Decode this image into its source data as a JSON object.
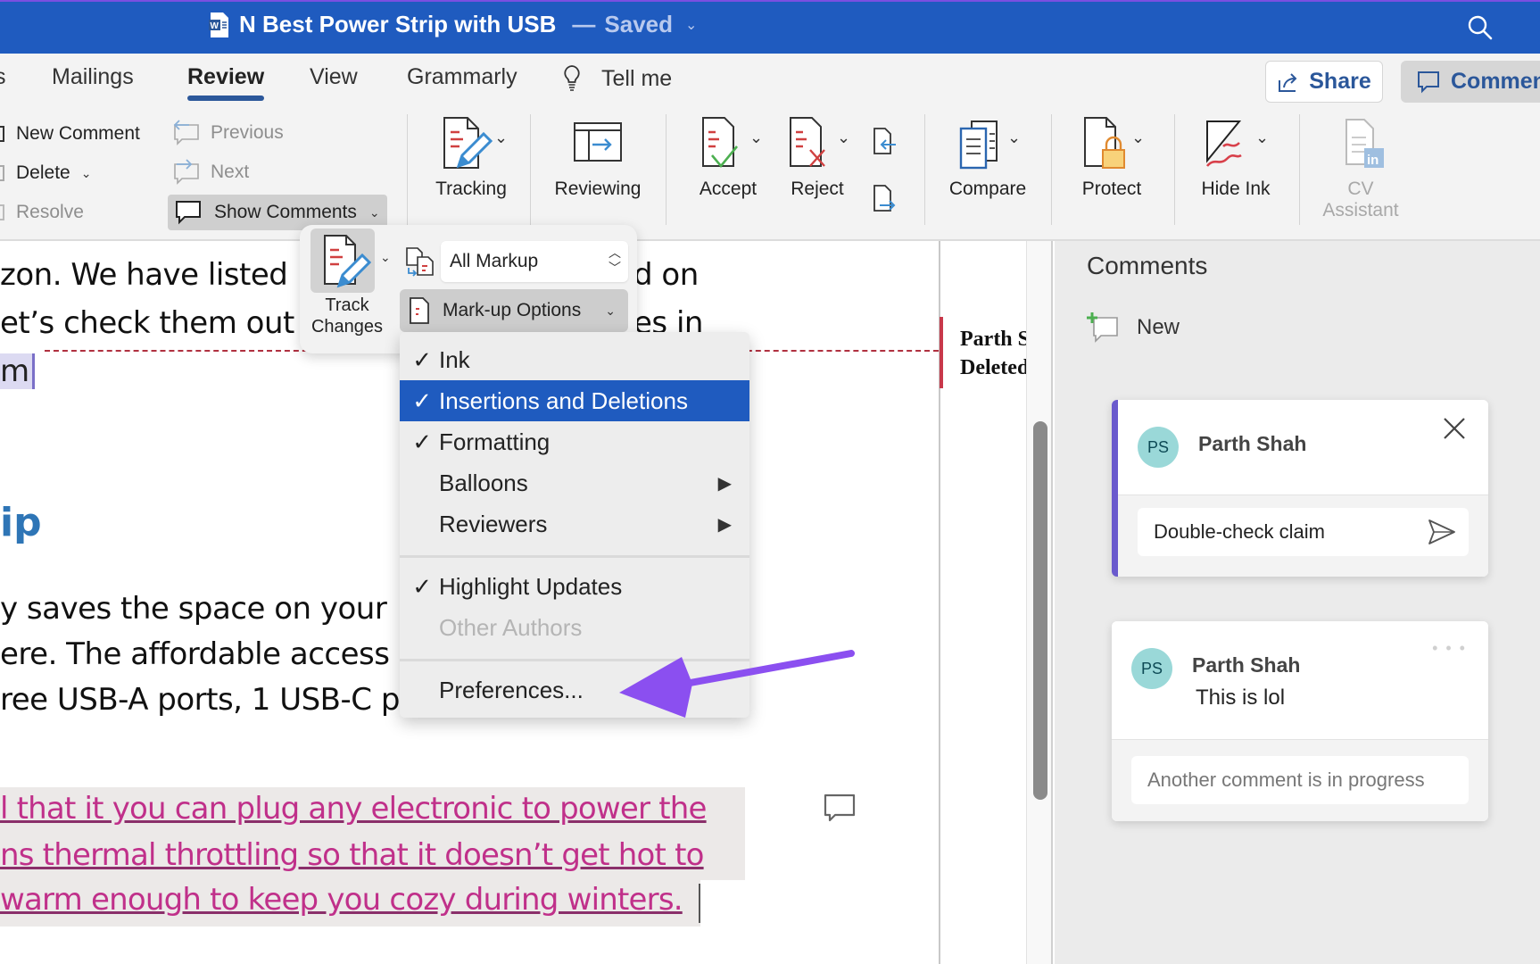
{
  "window": {
    "title": "N Best Power Strip with USB",
    "separator": "—",
    "status": "Saved",
    "title_bar_color": "#1f5bbf",
    "icons": {
      "app": "word-doc-icon",
      "search": "search-icon"
    }
  },
  "tabs": [
    {
      "label": "s",
      "partial": true
    },
    {
      "label": "Mailings"
    },
    {
      "label": "Review",
      "active": true
    },
    {
      "label": "View"
    },
    {
      "label": "Grammarly"
    },
    {
      "label": "Tell me",
      "icon": "lightbulb-icon"
    }
  ],
  "header_buttons": {
    "share": "Share",
    "comments": "Commen"
  },
  "ribbon": {
    "comments_group": {
      "new_comment": "New Comment",
      "delete": "Delete",
      "resolve": "Resolve",
      "previous": "Previous",
      "next": "Next",
      "show_comments": "Show Comments"
    },
    "big_buttons": {
      "tracking": "Tracking",
      "reviewing": "Reviewing",
      "accept": "Accept",
      "reject": "Reject",
      "compare": "Compare",
      "protect": "Protect",
      "hide_ink": "Hide Ink",
      "cv_line1": "CV",
      "cv_line2": "Assistant"
    }
  },
  "popover": {
    "track_changes_line1": "Track",
    "track_changes_line2": "Changes",
    "markup_select_value": "All Markup",
    "markup_options_label": "Mark-up Options"
  },
  "markup_menu": {
    "items": [
      {
        "label": "Ink",
        "checked": true
      },
      {
        "label": "Insertions and Deletions",
        "checked": true,
        "highlighted": true
      },
      {
        "label": "Formatting",
        "checked": true
      },
      {
        "label": "Balloons",
        "submenu": true
      },
      {
        "label": "Reviewers",
        "submenu": true
      },
      {
        "label": "Highlight Updates",
        "checked": true
      },
      {
        "label": "Other Authors",
        "disabled": true
      },
      {
        "label": "Preferences..."
      }
    ],
    "check_glyph": "✓",
    "submenu_glyph": "▶"
  },
  "document": {
    "lines_top": [
      "zon. We have listed",
      "et’s check them out"
    ],
    "lines_top_right": [
      "d on",
      "es in"
    ],
    "selected_fragment": "m",
    "heading_fragment": "ip",
    "body_lines": [
      "y saves the space on your",
      "ere. The affordable access",
      "ree USB-A ports, 1 USB-C p"
    ],
    "inserted_lines": [
      "l that it you can plug any electronic to power the",
      "ns thermal throttling so that it doesn’t get hot to",
      "warm enough to keep you cozy during winters."
    ],
    "insertion_color": "#c0308a",
    "heading_color": "#2e75b6"
  },
  "balloon": {
    "line1": "Parth S",
    "line2": "Deleted"
  },
  "comments_pane": {
    "title": "Comments",
    "new_label": "New",
    "threads": [
      {
        "initials": "PS",
        "author": "Parth Shah",
        "draft": "Double-check claim",
        "active": true
      },
      {
        "initials": "PS",
        "author": "Parth Shah",
        "text": "This is lol",
        "reply_placeholder": "Another comment is in progress"
      }
    ],
    "accent_color": "#6a5acd",
    "avatar_color": "#9ad8d8"
  },
  "annotation": {
    "arrow_color": "#8b4ff0",
    "points_to": "Preferences..."
  }
}
